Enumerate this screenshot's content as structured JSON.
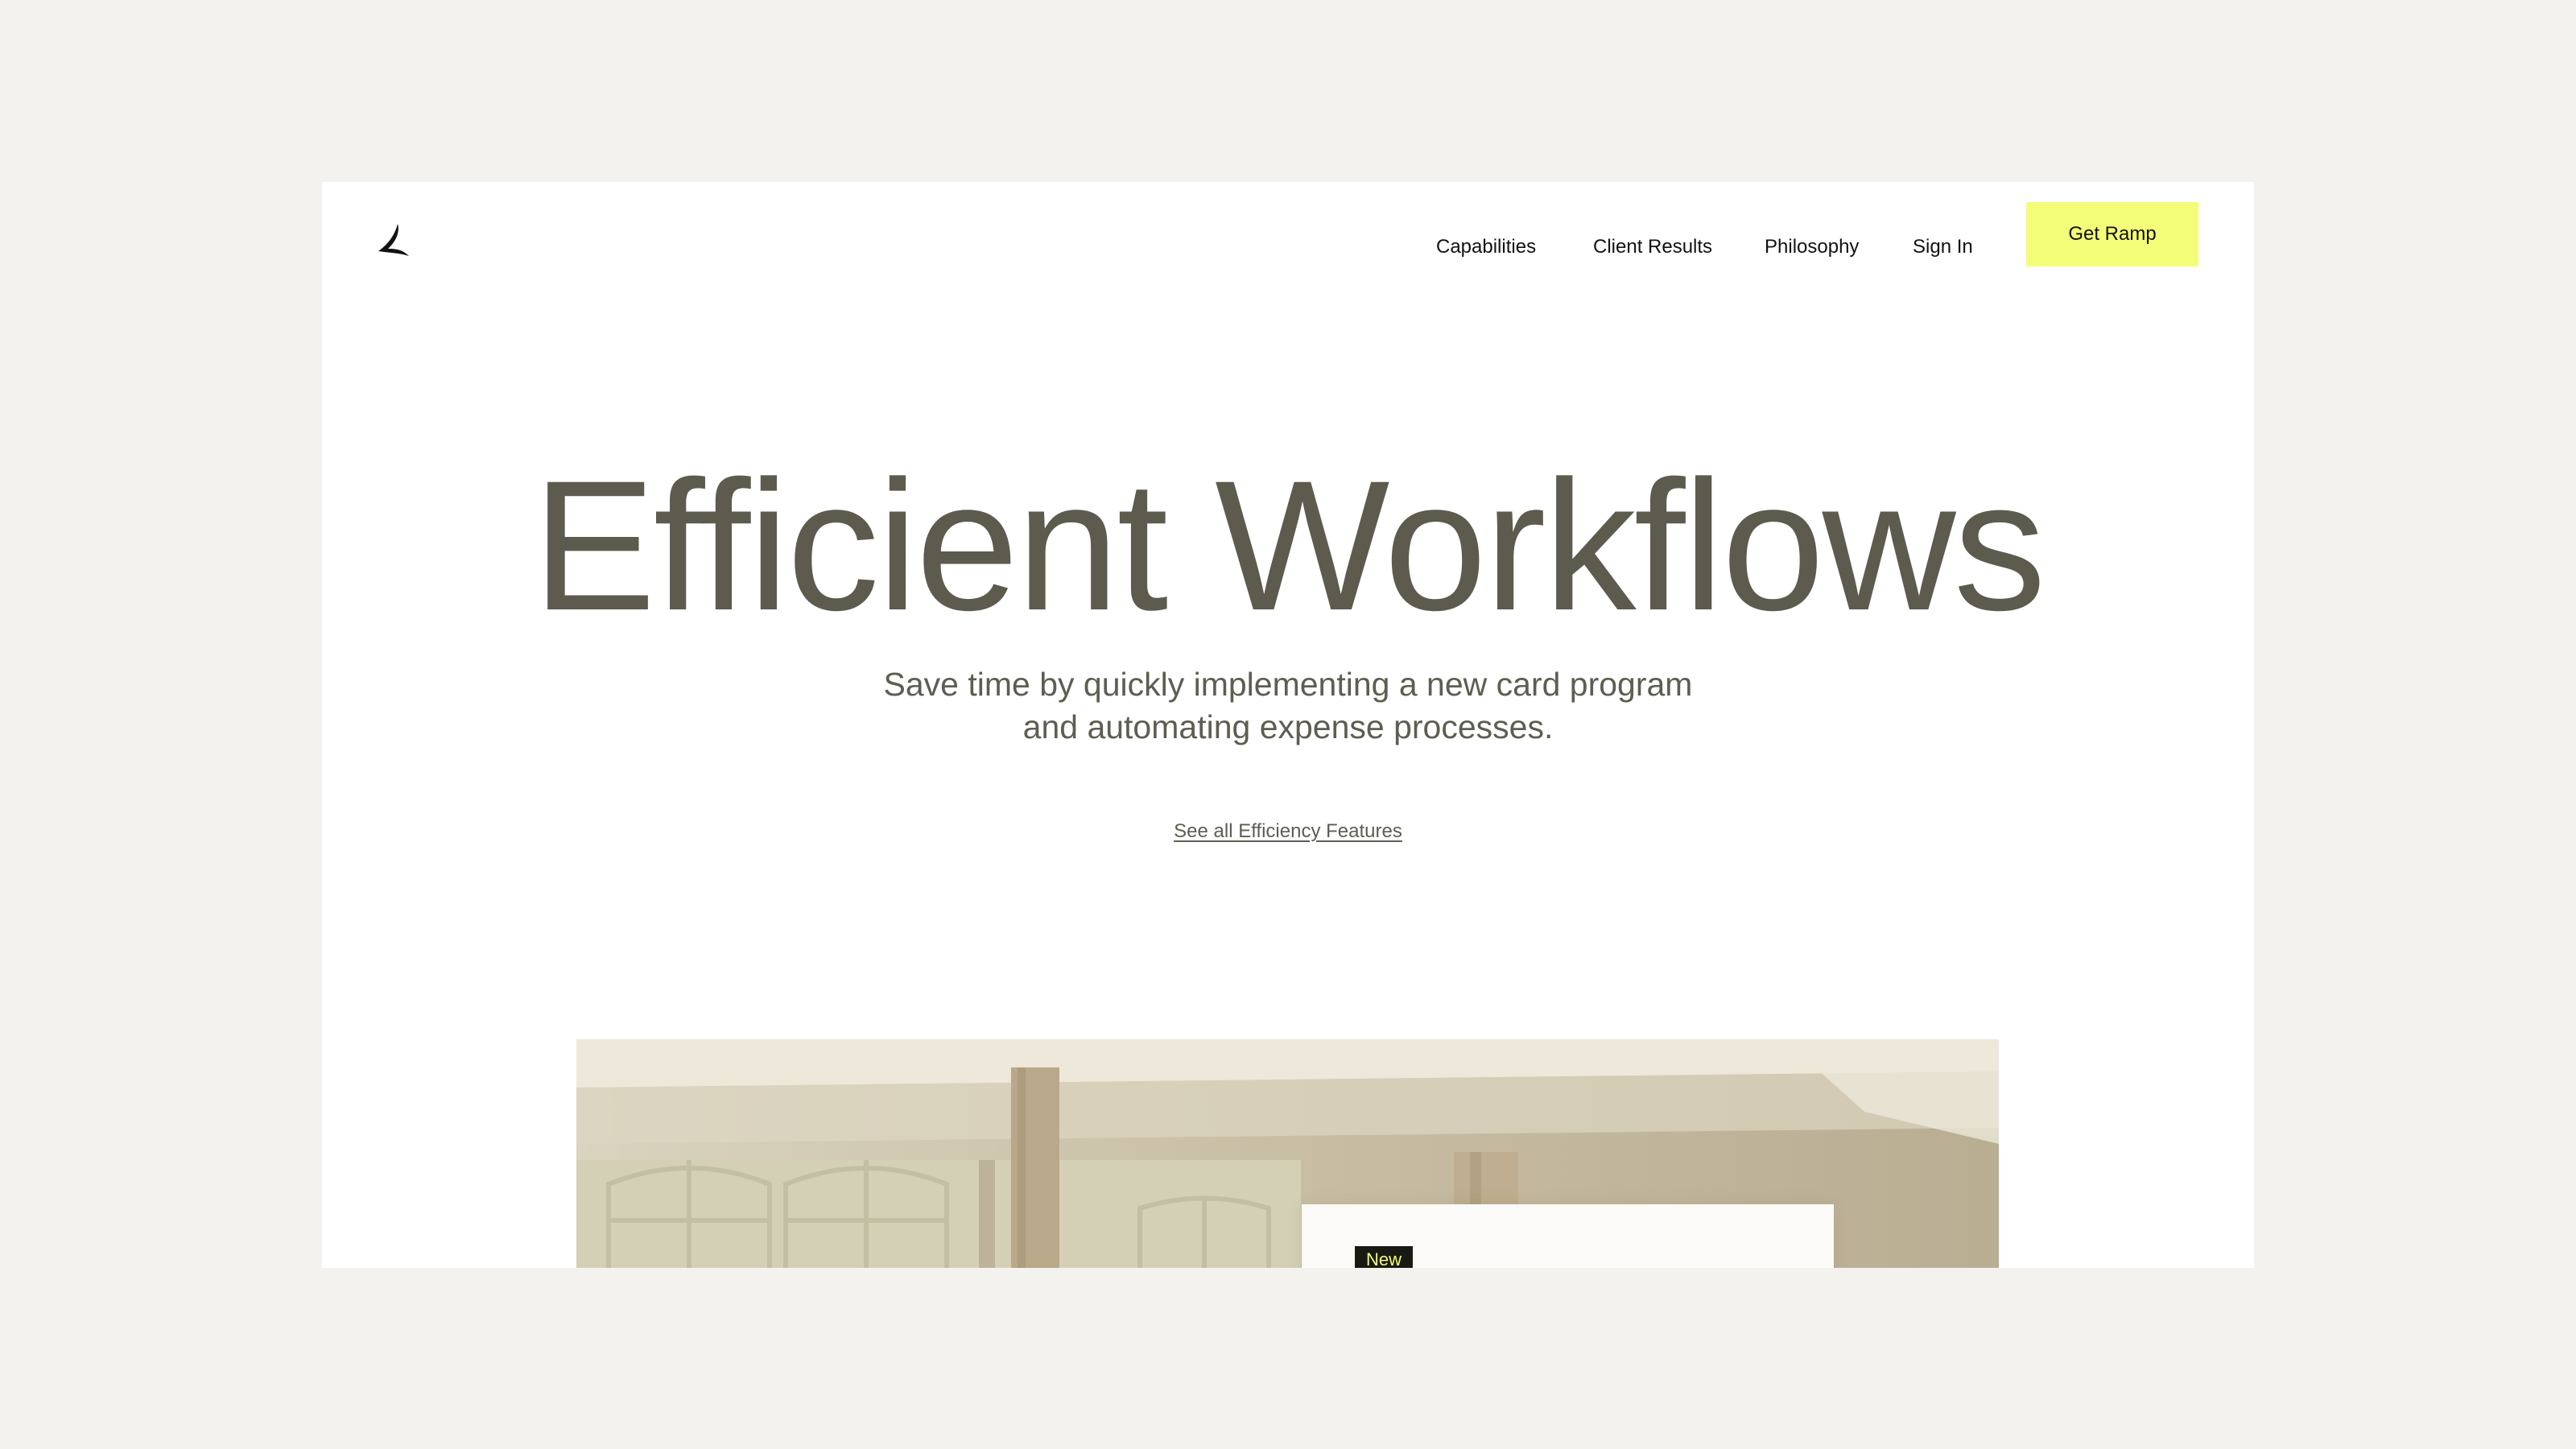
{
  "brand": {
    "logo_icon": "ramp-logo-icon",
    "accent_color": "#f4fd78",
    "text_color": "#5c5b4d"
  },
  "nav": {
    "items": [
      {
        "label": "Capabilities"
      },
      {
        "label": "Client Results"
      },
      {
        "label": "Philosophy"
      },
      {
        "label": "Sign In"
      }
    ],
    "cta_label": "Get Ramp"
  },
  "hero": {
    "title": "Efficient Workflows",
    "subtitle_line1": "Save time by quickly implementing a new card program",
    "subtitle_line2": "and automating expense processes.",
    "link_label": "See all Efficiency Features"
  },
  "feature_card": {
    "badge": "New"
  }
}
